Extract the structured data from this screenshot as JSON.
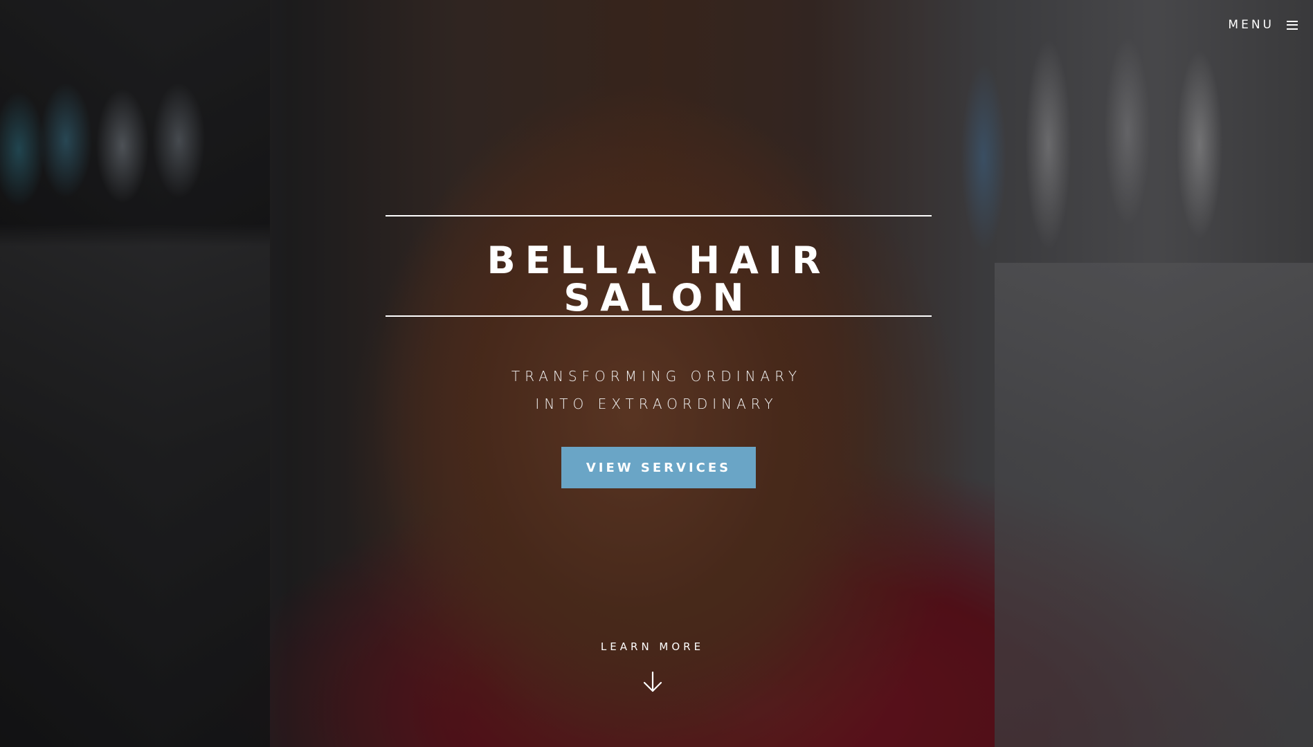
{
  "header": {
    "menu_label": "MENU",
    "menu_icon": "hamburger-icon"
  },
  "hero": {
    "title": "BELLA HAIR SALON",
    "tagline_line1": "TRANSFORMING ORDINARY",
    "tagline_line2": "INTO EXTRAORDINARY",
    "cta_label": "VIEW SERVICES",
    "learn_more_label": "LEARN MORE",
    "learn_more_icon": "arrow-down-icon"
  },
  "colors": {
    "accent": "#6aa5c6",
    "text": "#ffffff"
  }
}
